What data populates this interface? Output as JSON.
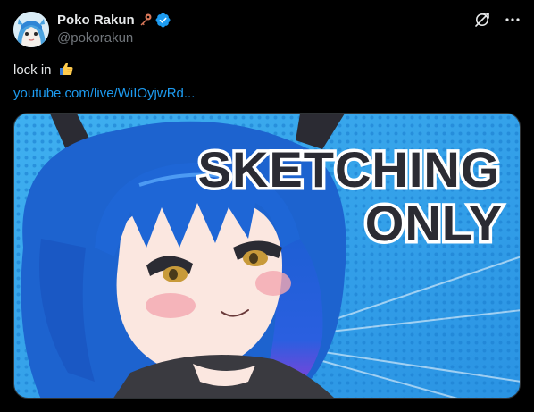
{
  "author": {
    "display_name": "Poko Rakun",
    "handle": "@pokorakun",
    "badge_icons": [
      "key-icon",
      "verified-icon"
    ],
    "verified_color": "#1d9bf0"
  },
  "actions": {
    "icons": [
      "grok-icon",
      "more-icon"
    ]
  },
  "tweet": {
    "text": "lock in",
    "emoji": "thumbs-up-emoji",
    "link_text": "youtube.com/live/WiIOyjwRd..."
  },
  "thumbnail": {
    "headline_line1": "SKETCHING",
    "headline_line2": "ONLY",
    "colors": {
      "background": "#2a9be6",
      "hair": "#1b5fd0",
      "text_fill": "#2b2b33",
      "text_outline": "#ffffff"
    }
  },
  "colors": {
    "background": "#000000",
    "text_primary": "#e7e9ea",
    "text_secondary": "#71767b",
    "link": "#1d9bf0"
  }
}
